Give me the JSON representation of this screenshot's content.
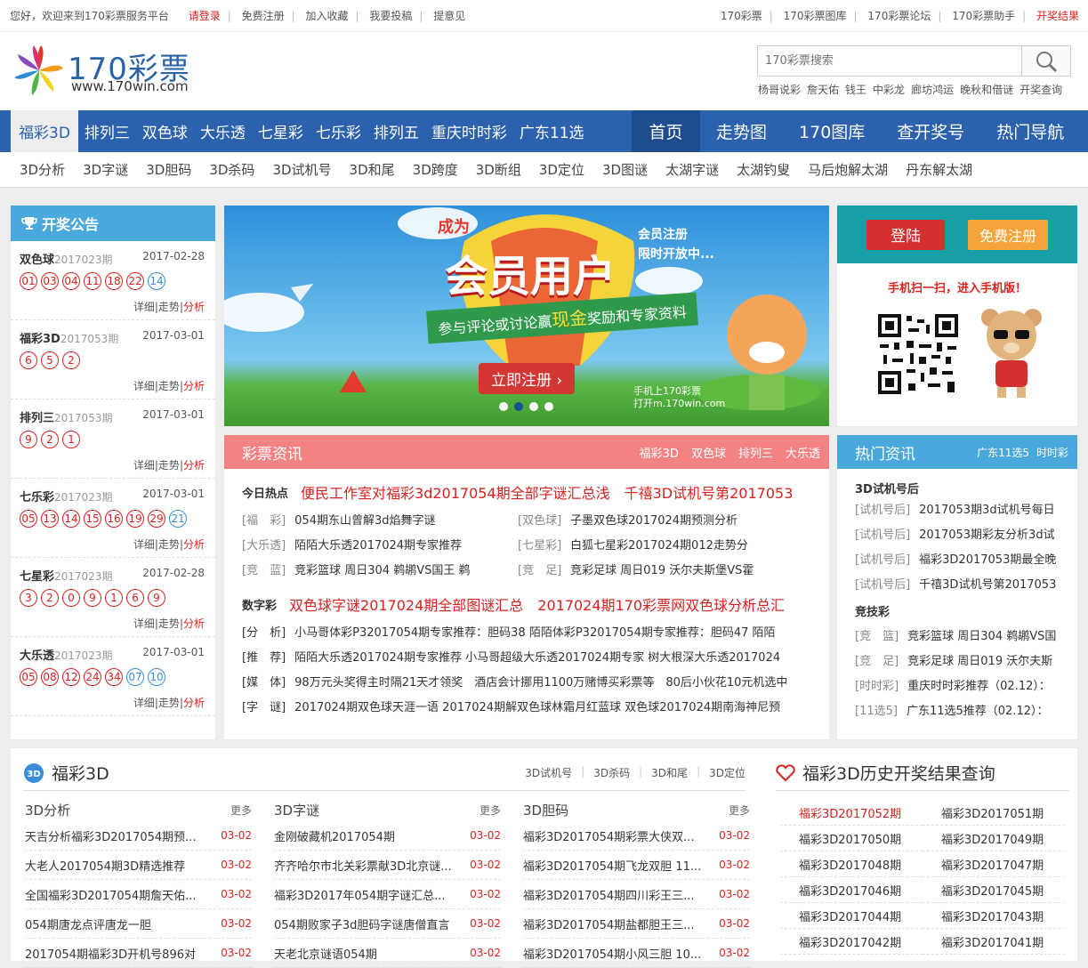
{
  "topbar": {
    "welcome": "您好，欢迎来到170彩票服务平台",
    "login": "请登录",
    "register": "免费注册",
    "fav": "加入收藏",
    "submit": "我要投稿",
    "feedback": "提意见",
    "links": [
      "170彩票",
      "170彩票图库",
      "170彩票论坛",
      "170彩票助手"
    ],
    "results": "开奖结果"
  },
  "logo": {
    "name": "170彩票",
    "url": "www.170win.com"
  },
  "search": {
    "placeholder": "170彩票搜索"
  },
  "hotwords": [
    "杨哥说彩",
    "詹天佑",
    "钱王",
    "中彩龙",
    "廊坊鸿运",
    "晚秋和借谜",
    "开奖查询"
  ],
  "nav": {
    "items": [
      "福彩3D",
      "排列三",
      "双色球",
      "大乐透",
      "七星彩",
      "七乐彩",
      "排列五",
      "重庆时时彩",
      "广东11选"
    ],
    "right": [
      "首页",
      "走势图",
      "170图库",
      "查开奖号",
      "热门导航"
    ]
  },
  "subnav": [
    "3D分析",
    "3D字谜",
    "3D胆码",
    "3D杀码",
    "3D试机号",
    "3D和尾",
    "3D跨度",
    "3D断组",
    "3D定位",
    "3D图谜",
    "太湖字谜",
    "太湖钓叟",
    "马后炮解太湖",
    "丹东解太湖"
  ],
  "announce": {
    "title": "开奖公告",
    "link_detail": "详细",
    "link_trend": "走势",
    "link_analysis": "分析",
    "draws": [
      {
        "name": "双色球",
        "period": "2017023期",
        "date": "2017-02-28",
        "red": [
          "01",
          "03",
          "04",
          "11",
          "18",
          "22"
        ],
        "blue": [
          "14"
        ]
      },
      {
        "name": "福彩3D",
        "period": "2017053期",
        "date": "2017-03-01",
        "red": [
          "6",
          "5",
          "2"
        ],
        "blue": []
      },
      {
        "name": "排列三",
        "period": "2017053期",
        "date": "2017-03-01",
        "red": [
          "9",
          "2",
          "1"
        ],
        "blue": []
      },
      {
        "name": "七乐彩",
        "period": "2017023期",
        "date": "2017-03-01",
        "red": [
          "05",
          "13",
          "14",
          "15",
          "16",
          "19",
          "29"
        ],
        "blue": [
          "21"
        ]
      },
      {
        "name": "七星彩",
        "period": "2017023期",
        "date": "2017-02-28",
        "red": [
          "3",
          "2",
          "0",
          "9",
          "1",
          "6",
          "9"
        ],
        "blue": []
      },
      {
        "name": "大乐透",
        "period": "2017023期",
        "date": "2017-03-01",
        "red": [
          "05",
          "08",
          "12",
          "24",
          "34"
        ],
        "blue": [
          "07",
          "10"
        ]
      }
    ]
  },
  "banner": {
    "top": "成为",
    "main": "会员用户",
    "side1": "会员注册",
    "side2": "限时开放中...",
    "ribbon_pre": "参与评论或讨论赢",
    "ribbon_hl": "现金",
    "ribbon_post": "奖励和专家资料",
    "cta": "立即注册 ›",
    "mobile1": "手机上170彩票",
    "mobile2": "打开m.170win.com"
  },
  "news": {
    "title": "彩票资讯",
    "tabs": [
      "福彩3D",
      "双色球",
      "排列三",
      "大乐透"
    ],
    "hot_label": "今日热点",
    "hot": [
      "便民工作室对福彩3d2017054期全部字谜汇总浅",
      "千禧3D试机号第2017053"
    ],
    "rows": [
      [
        {
          "tag": "[福　彩]",
          "text": "054期东山曾解3d焰舞字谜"
        },
        {
          "tag": "[双色球]",
          "text": "子墨双色球2017024期预测分析"
        }
      ],
      [
        {
          "tag": "[大乐透]",
          "text": "陌陌大乐透2017024期专家推荐"
        },
        {
          "tag": "[七星彩]",
          "text": "白狐七星彩2017024期012走势分"
        }
      ],
      [
        {
          "tag": "[竞　蓝]",
          "text": "竞彩篮球 周日304 鹈鹕VS国王 鹈"
        },
        {
          "tag": "[竞　足]",
          "text": "竞彩足球 周日019 沃尔夫斯堡VS霍"
        }
      ]
    ],
    "digit_label": "数字彩",
    "digit": [
      "双色球字谜2017024期全部图谜汇总",
      "2017024期170彩票网双色球分析总汇"
    ],
    "rows2": [
      {
        "tag": "[分　析]",
        "text": "小马哥体彩P32017054期专家推荐：胆码38 陌陌体彩P32017054期专家推荐：胆码47 陌陌"
      },
      {
        "tag": "[推　荐]",
        "text": "陌陌大乐透2017024期专家推荐 小马哥超级大乐透2017024期专家 树大根深大乐透2017024"
      },
      {
        "tag": "[媒　体]",
        "text": "98万元头奖得主时隔21天才领奖　酒店会计挪用1100万赌博买彩票等　80后小伙花10元机选中"
      },
      {
        "tag": "[字　谜]",
        "text": "2017024期双色球天涯一语 2017024期解双色球林霜月红蓝球 双色球2017024期南海神尼预"
      }
    ]
  },
  "user": {
    "login": "登陆",
    "register": "免费注册",
    "scan": "手机扫一扫，进入手机版！"
  },
  "hotnews": {
    "title": "热门资讯",
    "tabs": [
      "广东11选5",
      "时时彩"
    ],
    "sec1": "3D试机号后",
    "rows1": [
      {
        "tag": "[试机号后]",
        "text": "2017053期3d试机号每日"
      },
      {
        "tag": "[试机号后]",
        "text": "2017053期彩友分析3d试"
      },
      {
        "tag": "[试机号后]",
        "text": "福彩3D2017053期最全晚"
      },
      {
        "tag": "[试机号后]",
        "text": "千禧3D试机号第2017053"
      }
    ],
    "sec2": "竞技彩",
    "rows2": [
      {
        "tag": "[竞　篮]",
        "text": "竞彩篮球 周日304 鹈鹕VS国"
      },
      {
        "tag": "[竞　足]",
        "text": "竞彩足球 周日019 沃尔夫斯"
      },
      {
        "tag": "[时时彩]",
        "text": "重庆时时彩推荐（02.12）："
      },
      {
        "tag": "[11选5]",
        "text": "广东11选5推荐（02.12）："
      }
    ]
  },
  "fc3d": {
    "title": "福彩3D",
    "tabs": [
      "3D试机号",
      "3D杀码",
      "3D和尾",
      "3D定位"
    ],
    "more": "更多",
    "cols": [
      {
        "title": "3D分析",
        "items": [
          [
            "天吉分析福彩3D2017054期预...",
            "03-02"
          ],
          [
            "大老人2017054期3D精选推荐",
            "03-02"
          ],
          [
            "全国福彩3D2017054期詹天佑...",
            "03-02"
          ],
          [
            "054期唐龙点评唐龙一胆",
            "03-02"
          ],
          [
            "2017054期福彩3D开机号896对",
            "03-02"
          ]
        ]
      },
      {
        "title": "3D字谜",
        "items": [
          [
            "金刚破藏机2017054期",
            "03-02"
          ],
          [
            "齐齐哈尔市北关彩票献3D北京谜...",
            "03-02"
          ],
          [
            "福彩3D2017年054期字谜汇总...",
            "03-02"
          ],
          [
            "054期败家子3d胆码字谜唐僧直言",
            "03-02"
          ],
          [
            "天老北京谜语054期",
            "03-02"
          ]
        ]
      },
      {
        "title": "3D胆码",
        "items": [
          [
            "福彩3D2017054期彩票大侠双...",
            "03-02"
          ],
          [
            "福彩3D2017054期飞龙双胆 11...",
            "03-02"
          ],
          [
            "福彩3D2017054期四川彩王三...",
            "03-02"
          ],
          [
            "福彩3D2017054期盐都胆王三...",
            "03-02"
          ],
          [
            "福彩3D2017054期小风三胆 10...",
            "03-02"
          ]
        ]
      }
    ]
  },
  "history": {
    "title": "福彩3D历史开奖结果查询",
    "items": [
      "福彩3D2017052期",
      "福彩3D2017051期",
      "福彩3D2017050期",
      "福彩3D2017049期",
      "福彩3D2017048期",
      "福彩3D2017047期",
      "福彩3D2017046期",
      "福彩3D2017045期",
      "福彩3D2017044期",
      "福彩3D2017043期",
      "福彩3D2017042期",
      "福彩3D2017041期"
    ]
  },
  "colors": {
    "brand_blue": "#2b61ad",
    "accent_red": "#d8221f",
    "panel_blue": "#4aa9dc",
    "news_pink": "#f48282",
    "teal": "#17a0a6"
  }
}
